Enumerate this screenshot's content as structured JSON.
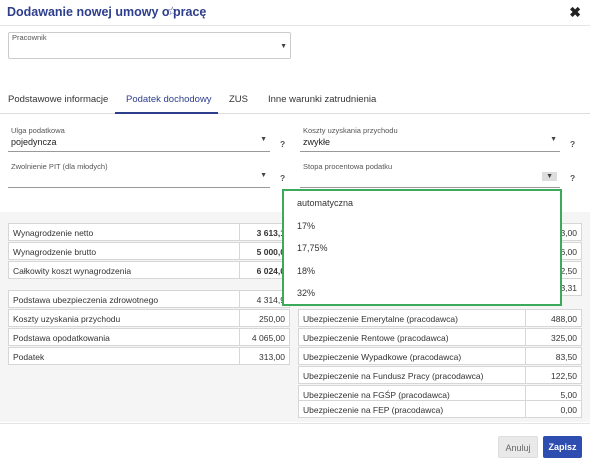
{
  "header": {
    "title": "Dodawanie nowej umowy o pracę",
    "star": "☆",
    "close": "✖"
  },
  "employee": {
    "label": "Pracownik",
    "value": ""
  },
  "tabs": [
    "Podstawowe informacje",
    "Podatek dochodowy",
    "ZUS",
    "Inne warunki zatrudnienia"
  ],
  "fields": {
    "ulga": {
      "label": "Ulga podatkowa",
      "value": "pojedyncza"
    },
    "koszty": {
      "label": "Koszty uzyskania przychodu",
      "value": "zwykłe"
    },
    "zwolnienie": {
      "label": "Zwolnienie PIT (dla młodych)",
      "value": ""
    },
    "stopa": {
      "label": "Stopa procentowa podatku",
      "value": ""
    },
    "help": "?"
  },
  "dropdown": {
    "options": [
      "automatyczna",
      "17%",
      "17,75%",
      "18%",
      "32%"
    ]
  },
  "left_top": [
    {
      "k": "Wynagrodzenie netto",
      "v": "3 613,1"
    },
    {
      "k": "Wynagrodzenie brutto",
      "v": "5 000,0"
    },
    {
      "k": "Całkowity koszt wynagrodzenia",
      "v": "6 024,0"
    }
  ],
  "left_bottom": [
    {
      "k": "Podstawa ubezpieczenia zdrowotnego",
      "v": "4 314,9"
    },
    {
      "k": "Koszty uzyskania przychodu",
      "v": "250,00"
    },
    {
      "k": "Podstawa opodatkowania",
      "v": "4 065,00"
    },
    {
      "k": "Podatek",
      "v": "313,00"
    }
  ],
  "right_partial": [
    "3,00",
    "6,00",
    "2,50",
    "3,31"
  ],
  "right_rows": [
    {
      "k": "Ubezpieczenie Emerytalne (pracodawca)",
      "v": "488,00"
    },
    {
      "k": "Ubezpieczenie Rentowe (pracodawca)",
      "v": "325,00"
    },
    {
      "k": "Ubezpieczenie Wypadkowe (pracodawca)",
      "v": "83,50"
    },
    {
      "k": "Ubezpieczenie na Fundusz Pracy (pracodawca)",
      "v": "122,50"
    },
    {
      "k": "Ubezpieczenie na FGŚP (pracodawca)",
      "v": "5,00"
    },
    {
      "k": "Ubezpieczenie na FEP (pracodawca)",
      "v": "0,00"
    }
  ],
  "footer": {
    "cancel": "Anuluj",
    "save": "Zapisz"
  }
}
